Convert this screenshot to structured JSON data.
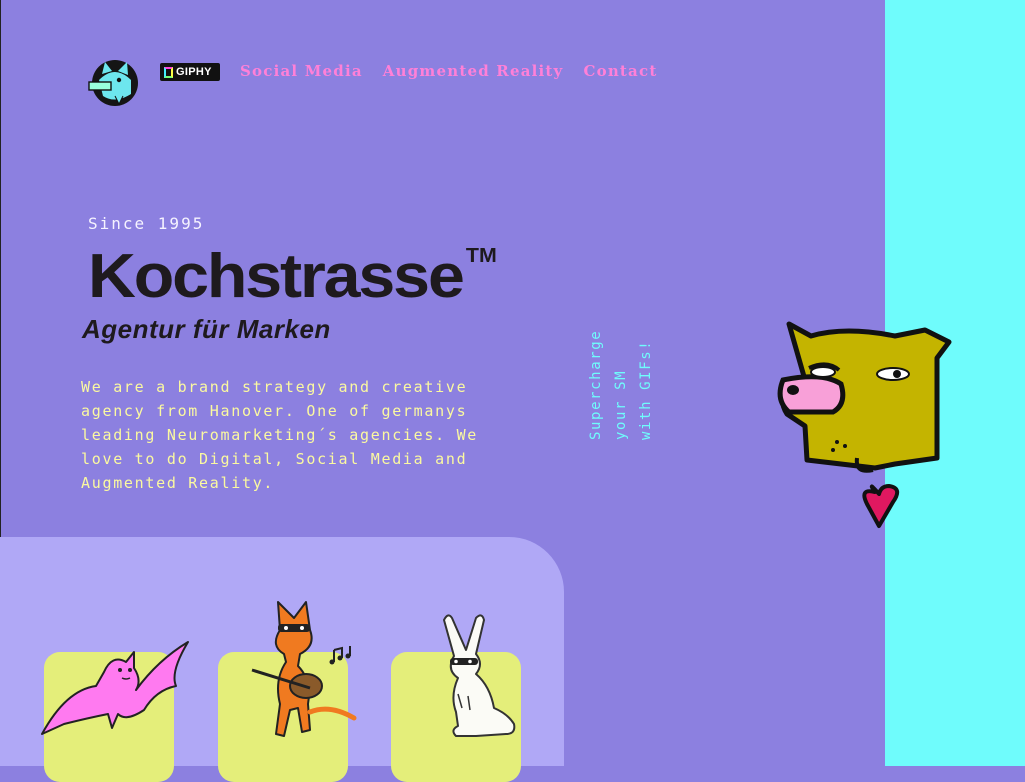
{
  "header": {
    "logo_icon": "wolf-avatar-icon",
    "giphy_badge": "GIPHY",
    "nav": [
      {
        "label": "Social Media"
      },
      {
        "label": "Augmented Reality"
      },
      {
        "label": "Contact"
      }
    ]
  },
  "hero": {
    "since": "Since 1995",
    "brand": "Kochstrasse",
    "trademark": "TM",
    "tagline": "Agentur für Marken",
    "about": "We are a brand strategy and creative agency from Hanover. One of germanys leading Neuromarketing´s agencies. We love to do Digital, Social Media and Augmented Reality."
  },
  "vertical_text": [
    "Supercharge",
    "your SM",
    "with GIFs!"
  ],
  "illustrations": {
    "dog": "dog-with-heart-icon",
    "gallery": [
      "bat-sticker",
      "fox-guitar-sticker",
      "rabbit-sticker"
    ]
  },
  "colors": {
    "background": "#8c80e0",
    "accent_panel": "#6ffcfc",
    "nav_link": "#ff80d8",
    "about_text": "#fbf9a0",
    "gallery_panel": "#b0a8f6",
    "card": "#e4ee7a"
  }
}
